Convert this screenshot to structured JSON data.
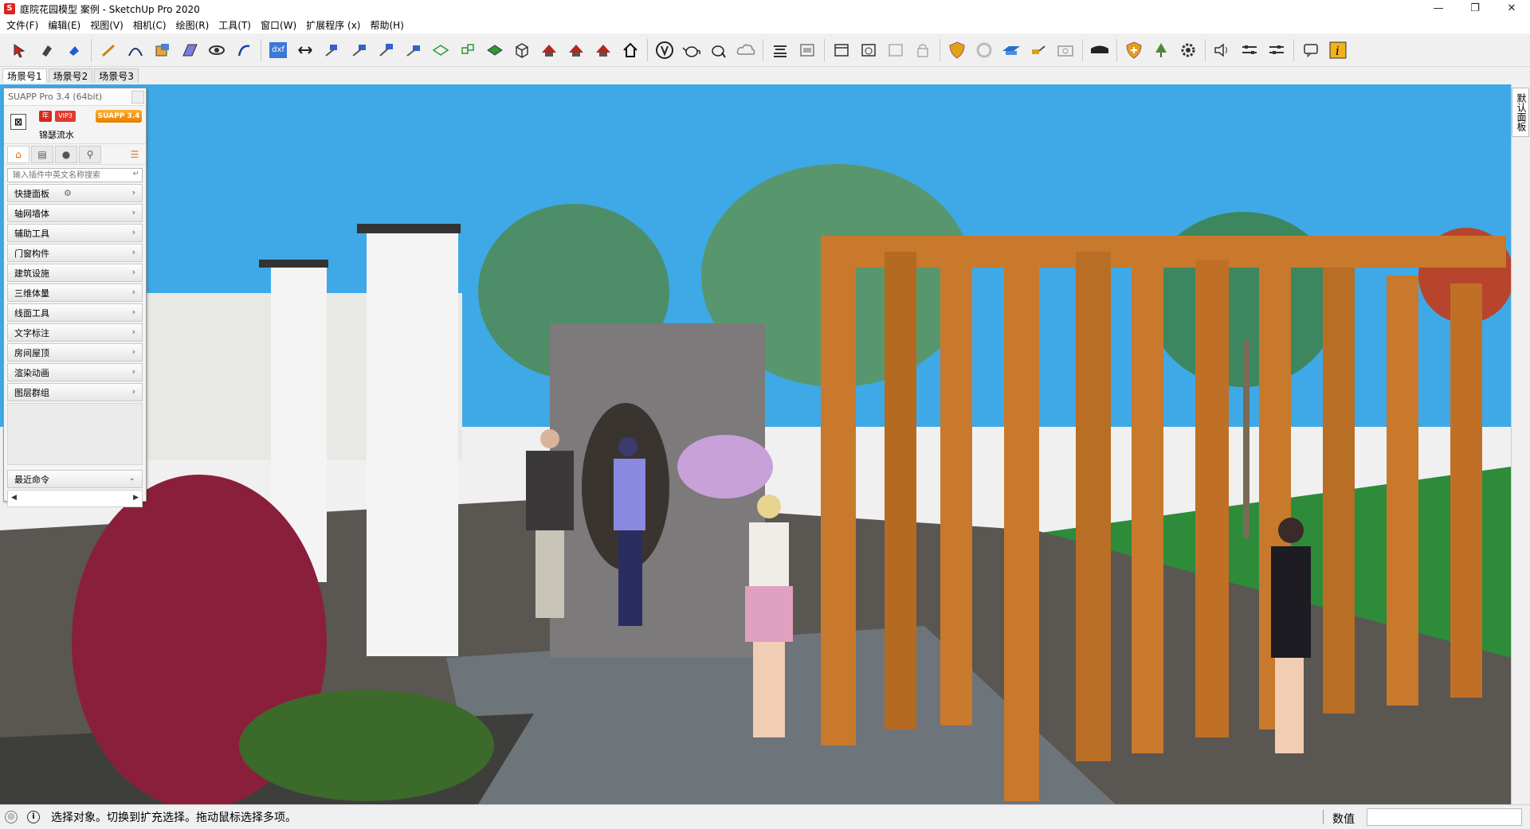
{
  "window": {
    "title": "庭院花园模型 案例 - SketchUp Pro 2020",
    "controls": {
      "minimize": "—",
      "restore": "❐",
      "close": "✕"
    }
  },
  "menu": [
    "文件(F)",
    "编辑(E)",
    "视图(V)",
    "相机(C)",
    "绘图(R)",
    "工具(T)",
    "窗口(W)",
    "扩展程序 (x)",
    "帮助(H)"
  ],
  "toolbar": {
    "dxf_label": "dxf",
    "icons": [
      "select-icon",
      "eraser-icon",
      "paint-bucket-icon",
      "line-icon",
      "arc-icon",
      "rectangle-icon",
      "push-pull-icon",
      "orbit-icon",
      "pan-icon",
      "dxf-import-icon",
      "move-icon",
      "tape-measure-icon",
      "protractor-icon",
      "section-plane-icon",
      "component-icon",
      "house-icon",
      "vray-icon",
      "teapot-icon",
      "cloud-icon",
      "shield-icon",
      "sync-icon",
      "light-icon",
      "camera-icon",
      "speaker-icon",
      "sliders-icon",
      "info-icon"
    ]
  },
  "scenes": [
    {
      "label": "场景号1",
      "active": true
    },
    {
      "label": "场景号2",
      "active": false
    },
    {
      "label": "场景号3",
      "active": false
    }
  ],
  "tray": {
    "tab_label": "默认面板"
  },
  "suapp": {
    "title": "SUAPP Pro 3.4 (64bit)",
    "avatar_glyph": "⊠",
    "badge_year": "年",
    "badge_vip": "VIP3",
    "badge_suapp": "SUAPP 3.4",
    "username": "锦瑟流水",
    "search_placeholder": "输入插件中英文名称搜索",
    "search_enter": "↵",
    "categories": [
      "快捷面板",
      "轴网墙体",
      "辅助工具",
      "门窗构件",
      "建筑设施",
      "三维体量",
      "线面工具",
      "文字标注",
      "房间屋顶",
      "渲染动画",
      "图层群组"
    ],
    "recent_label": "最近命令",
    "chevron": "›",
    "chevron_down": "⌄",
    "scroll_left": "◀",
    "scroll_right": "▶",
    "gear_glyph": "⚙",
    "iconbar": [
      "home-icon",
      "folder-icon",
      "user-icon",
      "search-icon",
      "list-icon"
    ]
  },
  "status": {
    "message": "选择对象。切换到扩充选择。拖动鼠标选择多项。",
    "info_glyph": "i",
    "geo_glyph": "◎",
    "measure_label": "数值",
    "measure_value": ""
  },
  "colors": {
    "sky": "#3ea9e6",
    "wood": "#c8792c",
    "grass": "#2e8b3a",
    "pavement": "#5a5652"
  }
}
